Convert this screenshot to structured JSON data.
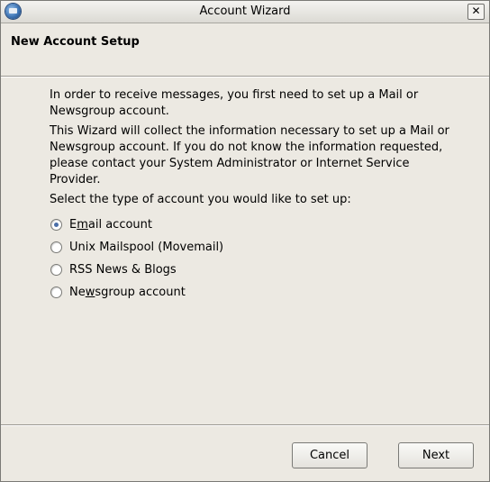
{
  "window": {
    "title": "Account Wizard",
    "close_glyph": "✕"
  },
  "header": {
    "title": "New Account Setup"
  },
  "content": {
    "para1": "In order to receive messages, you first need to set up a Mail or Newsgroup account.",
    "para2": "This Wizard will collect the information necessary to set up a Mail or Newsgroup account. If you do not know the information requested, please contact your System Administrator or Internet Service Provider.",
    "para3": "Select the type of account you would like to set up:"
  },
  "account_types": [
    {
      "label_pre": "E",
      "label_acc": "m",
      "label_post": "ail account",
      "checked": true
    },
    {
      "label_pre": "",
      "label_acc": "",
      "label_post": "Unix Mailspool (Movemail)",
      "checked": false
    },
    {
      "label_pre": "",
      "label_acc": "",
      "label_post": "RSS News & Blogs",
      "checked": false
    },
    {
      "label_pre": "Ne",
      "label_acc": "w",
      "label_post": "sgroup account",
      "checked": false
    }
  ],
  "buttons": {
    "cancel": "Cancel",
    "next": "Next"
  }
}
